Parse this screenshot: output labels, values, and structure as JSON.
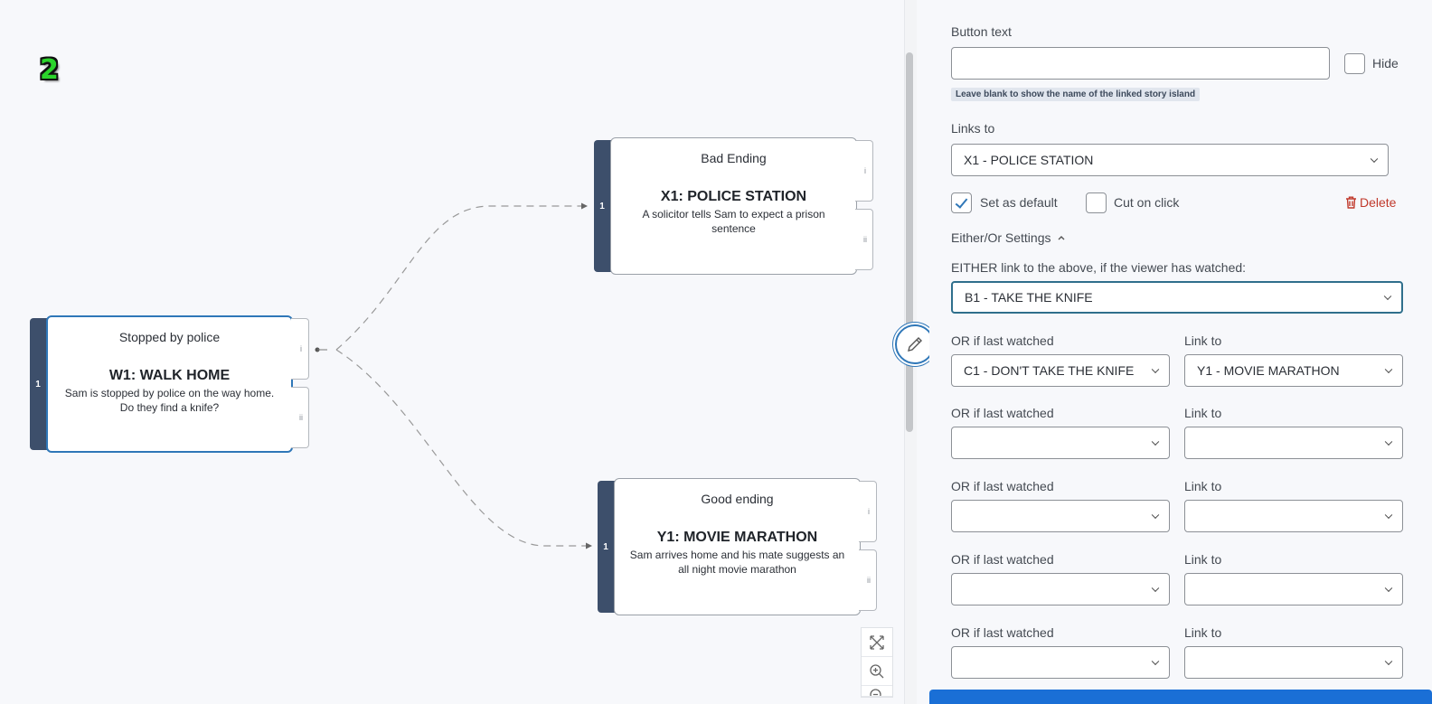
{
  "canvas": {
    "step_badge": "2",
    "islands": [
      {
        "id": "w1",
        "tab_number": "1",
        "chapter": "Stopped by police",
        "title": "W1: WALK HOME",
        "description": "Sam is stopped by police on the way home. Do they find a knife?",
        "selected": true,
        "outlets": [
          "i",
          "ii"
        ]
      },
      {
        "id": "x1",
        "tab_number": "1",
        "chapter": "Bad Ending",
        "title": "X1: POLICE STATION",
        "description": "A solicitor tells Sam to expect a prison sentence",
        "selected": false,
        "outlets": [
          "i",
          "ii"
        ]
      },
      {
        "id": "y1",
        "tab_number": "1",
        "chapter": "Good ending",
        "title": "Y1: MOVIE MARATHON",
        "description": "Sam arrives home and his mate suggests an all night movie marathon",
        "selected": false,
        "outlets": [
          "i",
          "ii"
        ]
      }
    ],
    "links": [
      {
        "from": "w1",
        "outlet": "i",
        "to": "x1",
        "style": "dashed"
      },
      {
        "from": "w1",
        "outlet": "i",
        "to": "y1",
        "style": "dashed"
      }
    ],
    "zoom_controls": [
      "fit-screen-icon",
      "zoom-in-icon",
      "zoom-out-icon"
    ]
  },
  "panel": {
    "button_text_label": "Button text",
    "button_text_value": "",
    "hide_label": "Hide",
    "hide_checked": false,
    "hint": "Leave blank to show the name of the linked story island",
    "links_to_label": "Links to",
    "links_to_value": "X1 - POLICE STATION",
    "set_default_label": "Set as default",
    "set_default_checked": true,
    "cut_on_click_label": "Cut on click",
    "cut_on_click_checked": false,
    "delete_label": "Delete",
    "either_or_label": "Either/Or Settings",
    "either_label": "EITHER link to the above, if the viewer has watched:",
    "either_value": "B1 - TAKE THE KNIFE",
    "or_rows": [
      {
        "watched_label": "OR if last watched",
        "watched_value": "C1 - DON'T TAKE THE KNIFE",
        "link_label": "Link to",
        "link_value": "Y1 - MOVIE MARATHON"
      },
      {
        "watched_label": "OR if last watched",
        "watched_value": "",
        "link_label": "Link to",
        "link_value": ""
      },
      {
        "watched_label": "OR if last watched",
        "watched_value": "",
        "link_label": "Link to",
        "link_value": ""
      },
      {
        "watched_label": "OR if last watched",
        "watched_value": "",
        "link_label": "Link to",
        "link_value": ""
      },
      {
        "watched_label": "OR if last watched",
        "watched_value": "",
        "link_label": "Link to",
        "link_value": ""
      }
    ]
  },
  "colors": {
    "accent": "#2f77b8",
    "island_tab": "#3d4f6b",
    "delete": "#c0392b",
    "badge": "#2bd42b",
    "primary_button": "#1a6fd6"
  }
}
